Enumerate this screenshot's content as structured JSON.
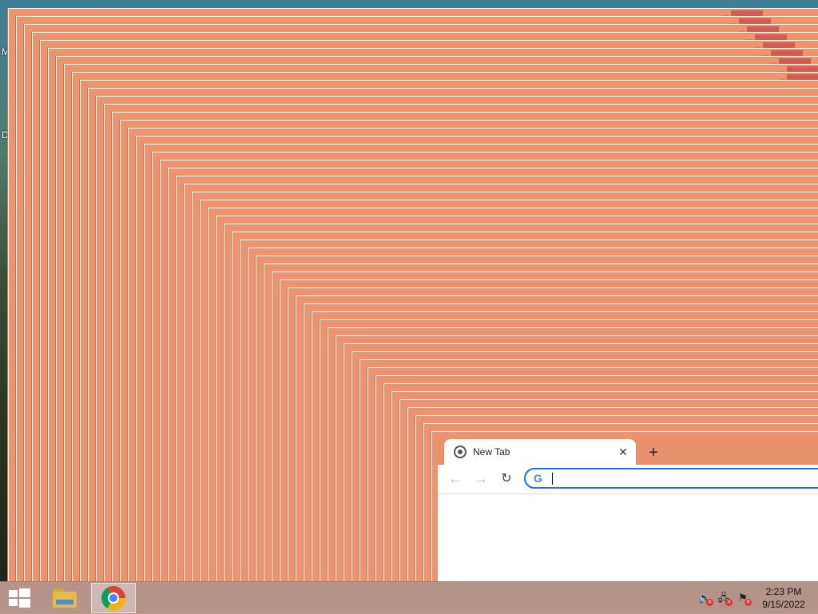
{
  "desktop": {
    "edge_labels": [
      "M",
      "D"
    ],
    "window_color": "#ec946e",
    "close_color": "#cf5c55"
  },
  "browser": {
    "tab": {
      "title": "New Tab",
      "icon": "chrome-icon",
      "close_glyph": "✕"
    },
    "new_tab_glyph": "+",
    "toolbar": {
      "back_glyph": "←",
      "forward_glyph": "→",
      "reload_glyph": "↻",
      "back_enabled": false,
      "forward_enabled": false
    },
    "omnibox": {
      "icon": "google-g-icon",
      "g_glyph": "G",
      "value": "",
      "placeholder": "",
      "focused": true,
      "accent_color": "#1a73e8"
    }
  },
  "taskbar": {
    "start": "windows-start-icon",
    "pinned": [
      {
        "name": "File Explorer",
        "icon": "file-explorer-icon"
      },
      {
        "name": "Google Chrome",
        "icon": "chrome-icon",
        "active": true
      }
    ],
    "tray": {
      "icons": [
        "volume-muted-icon",
        "network-error-icon",
        "action-center-flag-icon"
      ]
    },
    "clock": {
      "time": "2:23 PM",
      "date": "9/15/2022"
    }
  }
}
